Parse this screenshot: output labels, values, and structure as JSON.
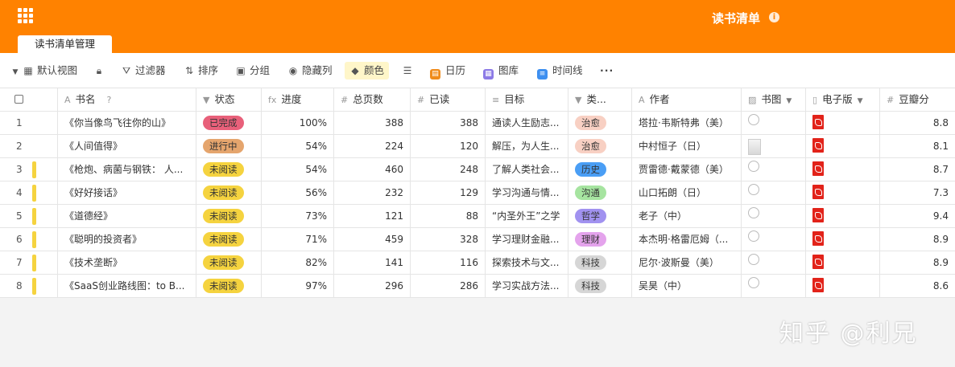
{
  "header": {
    "base_title": "读书清单",
    "table_tab": "读书清单管理"
  },
  "toolbar": {
    "view_label": "默认视图",
    "filter_label": "过滤器",
    "sort_label": "排序",
    "group_label": "分组",
    "hide_label": "隐藏列",
    "color_label": "颜色",
    "calendar_label": "日历",
    "gallery_label": "图库",
    "timeline_label": "时间线"
  },
  "columns": {
    "name": "书名",
    "status": "状态",
    "progress": "进度",
    "total": "总页数",
    "read": "已读",
    "goal": "目标",
    "category": "类...",
    "author": "作者",
    "cover": "书图",
    "ebook": "电子版",
    "douban": "豆瓣分"
  },
  "rows": [
    {
      "n": "1",
      "name": "《你当像鸟飞往你的山》",
      "status": "已完成",
      "progress": "100%",
      "total": "388",
      "read": "388",
      "goal": "通读人生励志...",
      "category": "治愈",
      "author": "塔拉·韦斯特弗（美）",
      "douban": "8.8"
    },
    {
      "n": "2",
      "name": "《人间值得》",
      "status": "进行中",
      "progress": "54%",
      "total": "224",
      "read": "120",
      "goal": "解压，为人生...",
      "category": "治愈",
      "author": "中村恒子（日）",
      "douban": "8.1"
    },
    {
      "n": "3",
      "name": "《枪炮、病菌与钢铁： 人...",
      "status": "未阅读",
      "progress": "54%",
      "total": "460",
      "read": "248",
      "goal": "了解人类社会...",
      "category": "历史",
      "author": "贾雷德·戴蒙德（美）",
      "douban": "8.7"
    },
    {
      "n": "4",
      "name": "《好好接话》",
      "status": "未阅读",
      "progress": "56%",
      "total": "232",
      "read": "129",
      "goal": "学习沟通与情...",
      "category": "沟通",
      "author": "山口拓朗（日）",
      "douban": "7.3"
    },
    {
      "n": "5",
      "name": "《道德经》",
      "status": "未阅读",
      "progress": "73%",
      "total": "121",
      "read": "88",
      "goal": "“内圣外王”之学",
      "category": "哲学",
      "author": "老子（中）",
      "douban": "9.4"
    },
    {
      "n": "6",
      "name": "《聪明的投资者》",
      "status": "未阅读",
      "progress": "71%",
      "total": "459",
      "read": "328",
      "goal": "学习理财金融...",
      "category": "理财",
      "author": "本杰明·格雷厄姆（...",
      "douban": "8.9"
    },
    {
      "n": "7",
      "name": "《技术垄断》",
      "status": "未阅读",
      "progress": "82%",
      "total": "141",
      "read": "116",
      "goal": "探索技术与文...",
      "category": "科技",
      "author": "尼尔·波斯曼（美）",
      "douban": "8.9"
    },
    {
      "n": "8",
      "name": "《SaaS创业路线图：to B...",
      "status": "未阅读",
      "progress": "97%",
      "total": "296",
      "read": "286",
      "goal": "学习实战方法...",
      "category": "科技",
      "author": "吴昊（中）",
      "douban": "8.6"
    }
  ],
  "colors": {
    "accent": "#ff8200",
    "status": {
      "已完成": "#e8607a",
      "进行中": "#e5a56d",
      "未阅读": "#f5d33f"
    },
    "category": {
      "治愈": "#f8d0c3",
      "历史": "#4a9ef5",
      "沟通": "#a6e4a0",
      "哲学": "#a192f0",
      "理财": "#e4a3ec",
      "科技": "#d6d6d6"
    }
  },
  "watermark": "知乎 @利兄"
}
